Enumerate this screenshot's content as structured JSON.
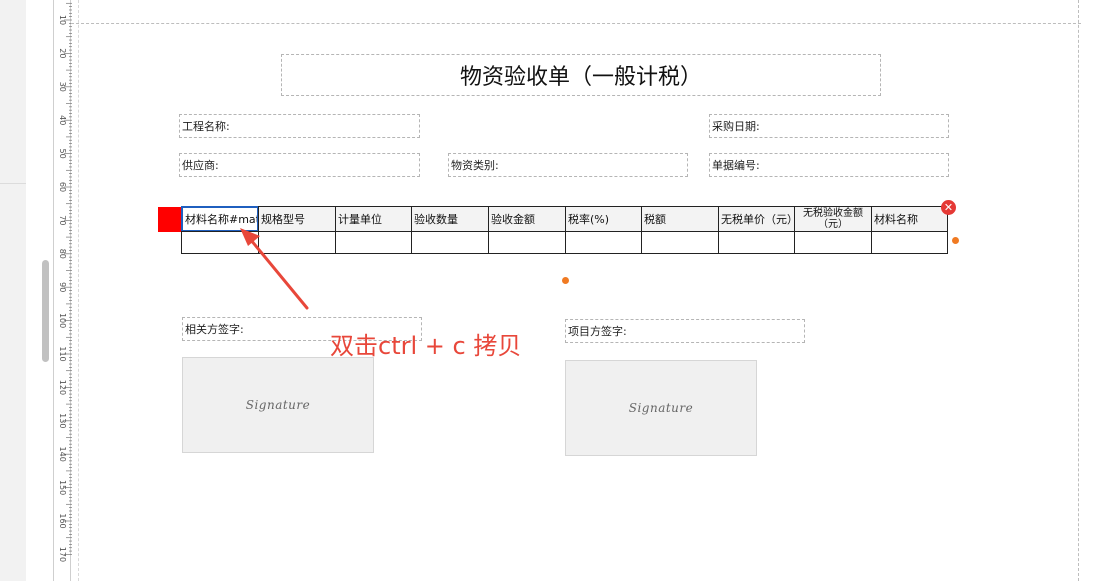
{
  "ruler": {
    "labels": [
      "10",
      "20",
      "30",
      "40",
      "50",
      "60",
      "70",
      "80",
      "90",
      "100",
      "110",
      "120",
      "130",
      "140",
      "150",
      "160",
      "170"
    ]
  },
  "form": {
    "title": "物资验收单（一般计税）",
    "fields": {
      "project_name": "工程名称:",
      "purchase_date": "采购日期:",
      "supplier": "供应商:",
      "material_category": "物资类别:",
      "document_number": "单据编号:",
      "related_party_signature": "相关方签字:",
      "project_party_signature": "项目方签字:"
    },
    "table": {
      "headers": [
        "材料名称#mat",
        "规格型号",
        "计量单位",
        "验收数量",
        "验收金额",
        "税率(%)",
        "税额",
        "无税单价（元）",
        "无税验收金额（元）",
        "材料名称"
      ]
    },
    "signature_placeholder": "Signature"
  },
  "annotation": {
    "text": "双击ctrl + c 拷贝"
  },
  "colors": {
    "accent": "#1f5fbf",
    "handle": "#ff0000",
    "annotation": "#e8473a",
    "dot": "#f07a22",
    "close": "#e53935"
  }
}
